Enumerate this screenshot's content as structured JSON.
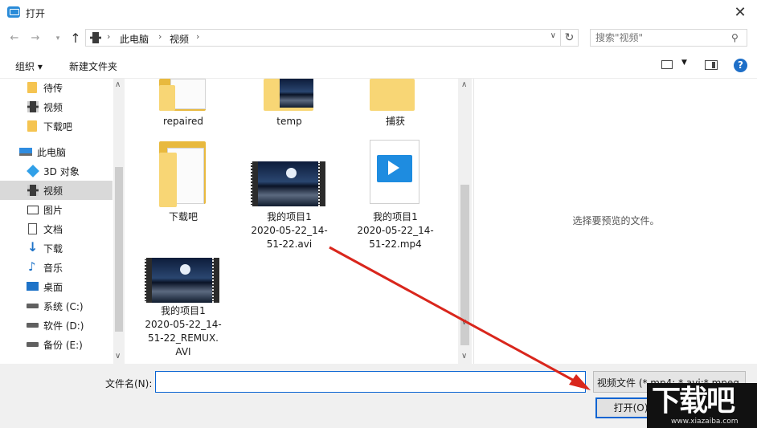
{
  "window": {
    "title": "打开",
    "close": "✕"
  },
  "address": {
    "crumbs": [
      "此电脑",
      "视频"
    ],
    "separator": "›",
    "search_placeholder": "搜索\"视频\""
  },
  "toolbar": {
    "organize": "组织 ▾",
    "new_folder": "新建文件夹"
  },
  "nav": {
    "items": [
      {
        "label": "待传",
        "icon": "folder-icon"
      },
      {
        "label": "视频",
        "icon": "video-icon"
      },
      {
        "label": "下载吧",
        "icon": "folder-icon"
      },
      {
        "label": "此电脑",
        "icon": "computer-icon"
      },
      {
        "label": "3D 对象",
        "icon": "3d-objects-icon"
      },
      {
        "label": "视频",
        "icon": "video-icon",
        "selected": true
      },
      {
        "label": "图片",
        "icon": "pictures-icon"
      },
      {
        "label": "文档",
        "icon": "documents-icon"
      },
      {
        "label": "下载",
        "icon": "download-icon"
      },
      {
        "label": "音乐",
        "icon": "music-icon"
      },
      {
        "label": "桌面",
        "icon": "desktop-icon"
      },
      {
        "label": "系统 (C:)",
        "icon": "drive-icon"
      },
      {
        "label": "软件 (D:)",
        "icon": "drive-icon"
      },
      {
        "label": "备份 (E:)",
        "icon": "drive-icon"
      }
    ]
  },
  "files": [
    {
      "label": "repaired",
      "type": "folder"
    },
    {
      "label": "temp",
      "type": "folder-video"
    },
    {
      "label": "捕获",
      "type": "folder"
    },
    {
      "label": "下载吧",
      "type": "folder"
    },
    {
      "label": "我的项目1\n2020-05-22_14-\n51-22.avi",
      "type": "video"
    },
    {
      "label": "我的项目1\n2020-05-22_14-\n51-22.mp4",
      "type": "mp4"
    },
    {
      "label": "我的项目1\n2020-05-22_14-\n51-22_REMUX.\nAVI",
      "type": "video"
    }
  ],
  "preview": {
    "empty_text": "选择要预览的文件。"
  },
  "bottom": {
    "filename_label": "文件名(N):",
    "filename_value": "",
    "filter_value": "视频文件 (*.mp4; *.avi;*.mpeg",
    "open_label": "打开(O)"
  },
  "watermark": {
    "text": "下载吧",
    "url": "www.xiazaiba.com"
  },
  "colors": {
    "accent": "#0a64d2",
    "annotation_arrow": "#d9261c",
    "folder": "#f8d675"
  }
}
